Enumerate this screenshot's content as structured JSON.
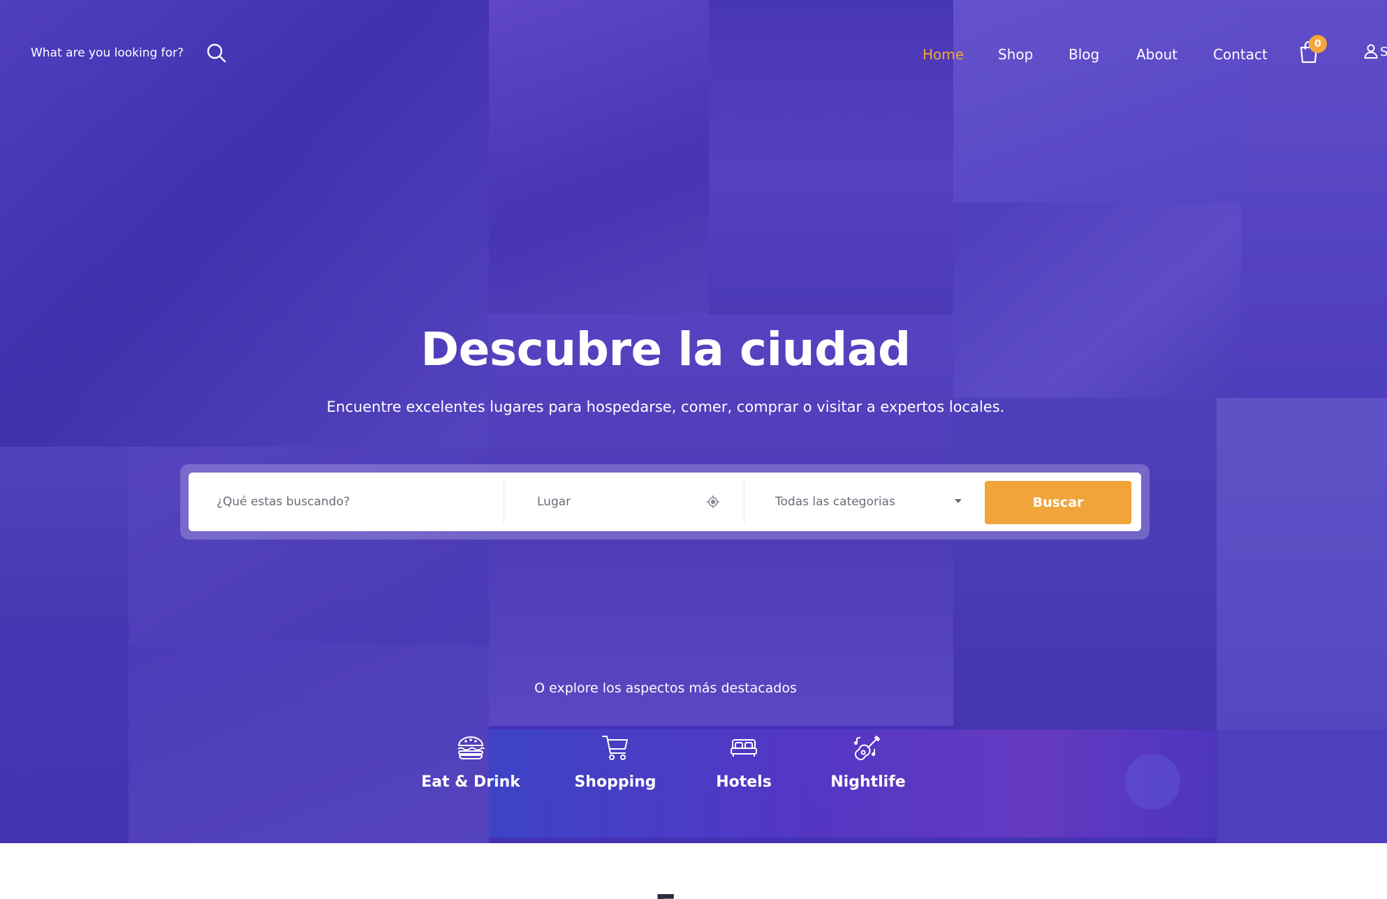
{
  "header": {
    "search_hint": "What are you looking for?",
    "nav": [
      "Home",
      "Shop",
      "Blog",
      "About",
      "Contact"
    ],
    "active_nav": "Home",
    "cart_count": "0",
    "user_label": "S"
  },
  "hero": {
    "title": "Descubre la ciudad",
    "subtitle": "Encuentre excelentes lugares para hospedarse, comer, comprar o visitar a expertos locales."
  },
  "search_form": {
    "keyword_placeholder": "¿Qué estas buscando?",
    "location_placeholder": "Lugar",
    "category_selected": "Todas las categorias",
    "submit_label": "Buscar"
  },
  "explore": {
    "label": "O explore los aspectos más destacados",
    "categories": [
      {
        "label": "Eat & Drink",
        "icon": "burger-icon"
      },
      {
        "label": "Shopping",
        "icon": "cart-icon"
      },
      {
        "label": "Hotels",
        "icon": "bed-icon"
      },
      {
        "label": "Nightlife",
        "icon": "guitar-icon"
      }
    ]
  },
  "below": {
    "title": "E"
  },
  "colors": {
    "accent": "#f0a43a",
    "hero_overlay": "#4a36b8",
    "text_light": "#ffffff"
  }
}
